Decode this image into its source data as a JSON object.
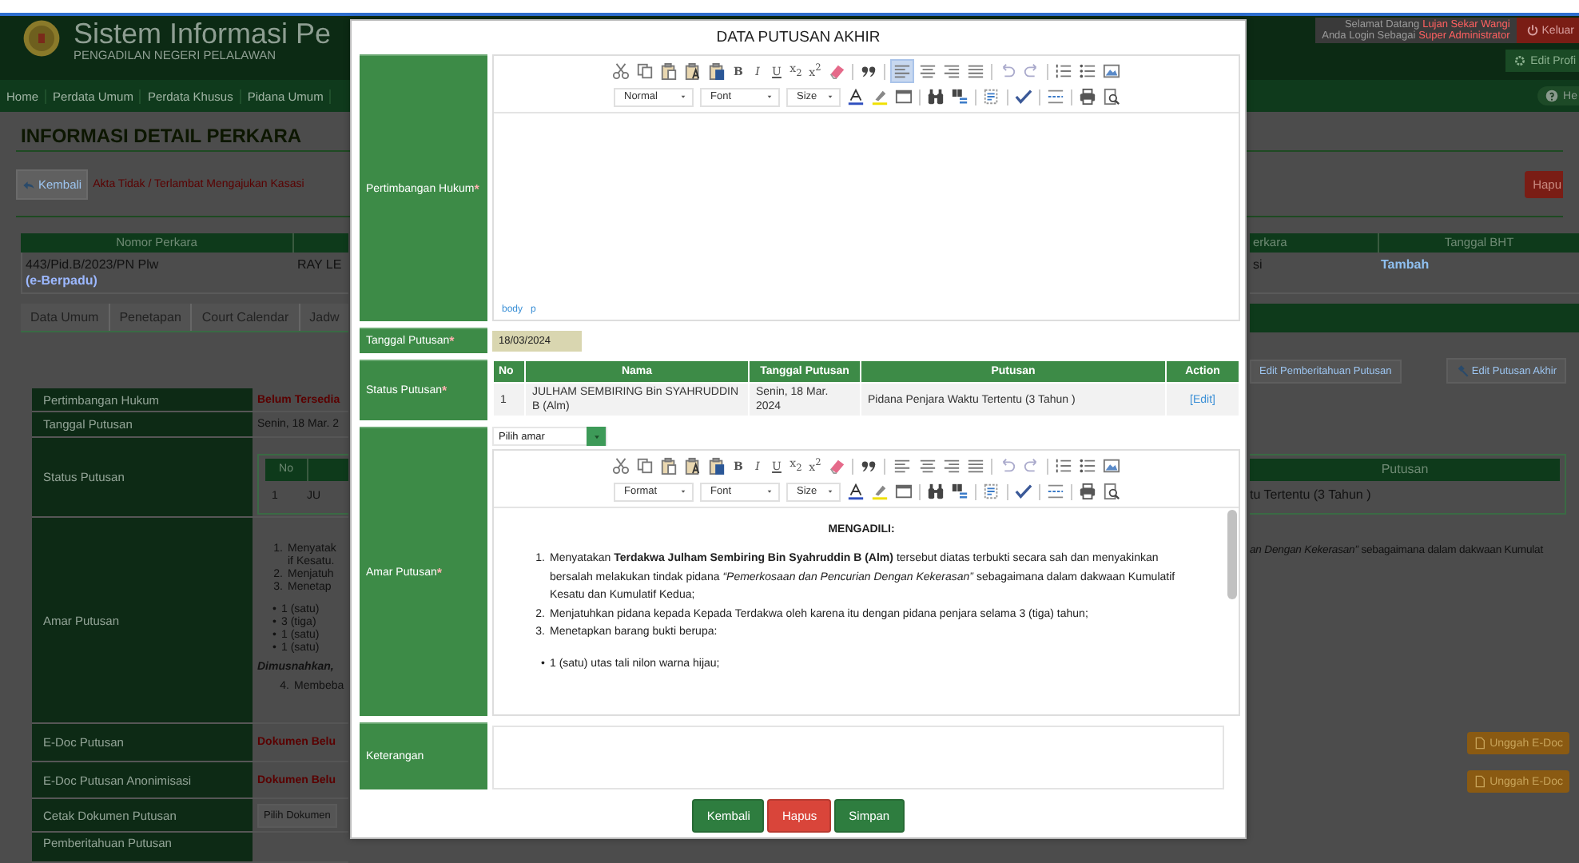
{
  "header": {
    "title": "Sistem Informasi Pe",
    "subtitle": "PENGADILAN NEGERI PELALAWAN",
    "welcome_label": "Selamat Datang",
    "user_name": "Lujan Sekar Wangi",
    "role_label": "Anda Login Sebagai",
    "role": "Super Administrator",
    "logout_button": "Keluar",
    "profile_button": "Edit Profi"
  },
  "nav": {
    "items": [
      "Home",
      "Perdata Umum",
      "Perdata Khusus",
      "Pidana Umum"
    ],
    "help_button": "He"
  },
  "page": {
    "heading": "INFORMASI DETAIL PERKARA",
    "back_button": "Kembali",
    "notice": "Akta Tidak / Terlambat Mengajukan Kasasi",
    "delete_button": "Hapu"
  },
  "case_table": {
    "columns": [
      "Nomor Perkara",
      "erkara",
      "Tanggal BHT"
    ],
    "row": {
      "case_number": "443/Pid.B/2023/PN Plw",
      "tag": "(e-Berpadu)",
      "party": "RAY LE",
      "status": "si",
      "bht": "Tambah"
    }
  },
  "tabs": [
    "Data Umum",
    "Penetapan",
    "Court Calendar",
    "Jadw"
  ],
  "actions": [
    "Edit Pemberitahuan Putusan",
    "Edit Putusan Akhir"
  ],
  "details": [
    {
      "kind": "text",
      "label": "Pertimbangan Hukum",
      "value": "Belum Tersedia",
      "alert": true
    },
    {
      "kind": "text",
      "label": "Tanggal Putusan",
      "value": "Senin, 18 Mar. 2",
      "alert": false
    },
    {
      "kind": "status",
      "label": "Status Putusan",
      "columns": [
        "No"
      ],
      "row": [
        "1",
        "JU"
      ],
      "right_column": "Putusan",
      "right_cell": "tu Tertentu (3 Tahun )"
    },
    {
      "kind": "amar",
      "label": "Amar Putusan",
      "items": [
        {
          "number": "1.",
          "lines": [
            "Menyatak",
            "if Kesatu."
          ]
        },
        {
          "number": "2.",
          "lines": [
            "Menjatuh"
          ]
        },
        {
          "number": "3.",
          "lines": [
            "Menetap"
          ]
        }
      ],
      "bullets": [
        {
          "bullet": "•",
          "text": "1 (satu)"
        },
        {
          "bullet": "•",
          "text": "3 (tiga)"
        },
        {
          "bullet": "•",
          "text": "1 (satu)"
        },
        {
          "bullet": "•",
          "text": "1 (satu)"
        }
      ],
      "note": "Dimusnahkan,",
      "final": {
        "number": "4.",
        "text": "Membeba"
      },
      "right_text": "*an Dengan Kekerasan”* sebagaimana dalam dakwaan Kumulat"
    },
    {
      "kind": "doc",
      "label": "E-Doc Putusan",
      "value": "Dokumen Belu",
      "upload_button": "Unggah E-Doc"
    },
    {
      "kind": "doc",
      "label": "E-Doc Putusan Anonimisasi",
      "value": "Dokumen Belu",
      "upload_button": "Unggah E-Doc"
    },
    {
      "kind": "select",
      "label": "Cetak Dokumen Putusan",
      "value": "Pilih Dokumen"
    },
    {
      "kind": "empty",
      "label": "Pemberitahuan Putusan"
    }
  ],
  "modal": {
    "title": "DATA PUTUSAN AKHIR",
    "fields": [
      {
        "kind": "editor",
        "label": "Pertimbangan Hukum",
        "required_mark": "*",
        "editor": {
          "style_dropdown": "Normal",
          "font_dropdown": "Font",
          "size_dropdown": "Size",
          "format_buttons": [
            "B",
            "I",
            "U",
            "x$_{2}$",
            "x$^{2}$"
          ],
          "align_left_on": true,
          "path": [
            "body",
            "p"
          ]
        }
      },
      {
        "kind": "date",
        "label": "Tanggal Putusan",
        "required_mark": "*",
        "value": "18/03/2024"
      },
      {
        "kind": "table",
        "label": "Status Putusan",
        "required_mark": "*",
        "columns": [
          "No",
          "Nama",
          "Tanggal Putusan",
          "Putusan",
          "Action"
        ],
        "rows": [
          {
            "no": "1",
            "name": "JULHAM SEMBIRING Bin SYAHRUDDIN B (Alm)",
            "date": "Senin, 18 Mar. 2024",
            "verdict": "Pidana Penjara Waktu Tertentu (3 Tahun )",
            "action": "[Edit]"
          }
        ]
      },
      {
        "kind": "amar",
        "label": "Amar Putusan",
        "required_mark": "*",
        "select": "Pilih amar",
        "editor": {
          "style_dropdown": "Format",
          "font_dropdown": "Font",
          "size_dropdown": "Size",
          "format_buttons": [
            "B",
            "I",
            "U",
            "x$_{2}$",
            "x$^{2}$"
          ],
          "align_left_on": false,
          "content": {
            "heading": "MENGADILI:",
            "items": [
              {
                "number": "1.",
                "text": "Menyatakan **Terdakwa Julham Sembiring Bin Syahruddin B (Alm)** tersebut diatas terbukti secara sah dan menyakinkan bersalah melakukan tindak pidana *“Pemerkosaan dan Pencurian Dengan Kekerasan”* sebagaimana dalam dakwaan Kumulatif Kesatu dan Kumulatif Kedua;"
              },
              {
                "number": "2.",
                "text": "Menjatuhkan pidana kepada Kepada Terdakwa oleh karena itu dengan pidana penjara selama 3 (tiga) tahun;"
              },
              {
                "number": "3.",
                "text": "Menetapkan barang bukti berupa:"
              }
            ],
            "bullets": [
              {
                "bullet": "•",
                "text": "1 (satu) utas tali nilon warna hijau;"
              }
            ]
          }
        }
      },
      {
        "kind": "textarea",
        "label": "Keterangan"
      }
    ],
    "buttons": [
      {
        "label": "Kembali",
        "kind": "back"
      },
      {
        "label": "Hapus",
        "kind": "delete"
      },
      {
        "label": "Simpan",
        "kind": "save"
      }
    ]
  }
}
